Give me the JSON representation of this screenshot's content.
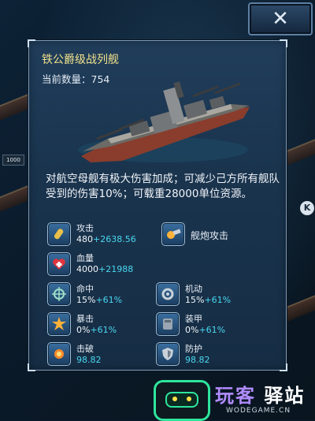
{
  "window": {
    "close_label": "✕"
  },
  "background": {
    "tag": "1000"
  },
  "side_button": {
    "label": "K"
  },
  "ship": {
    "name": "铁公爵级战列舰",
    "count_label": "当前数量：",
    "count": "754",
    "description": "对航空母舰有极大伤害加成；可减少己方所有舰队受到的伤害10%；可载重28000单位资源。"
  },
  "primary_stats": [
    {
      "icon": "bullet-icon",
      "label": "攻击",
      "base": "480",
      "bonus": "+2638.56"
    },
    {
      "icon": "heart-cross-icon",
      "label": "血量",
      "base": "4000",
      "bonus": "+21988"
    }
  ],
  "attack_type": {
    "icon": "naval-gun-icon",
    "label": "舰炮攻击"
  },
  "secondary_stats": [
    {
      "icon": "crosshair-icon",
      "label": "命中",
      "base": "15%",
      "bonus": "+61%"
    },
    {
      "icon": "maneuver-icon",
      "label": "机动",
      "base": "15%",
      "bonus": "+61%"
    },
    {
      "icon": "critical-burst-icon",
      "label": "暴击",
      "base": "0%",
      "bonus": "+61%"
    },
    {
      "icon": "armor-plate-icon",
      "label": "装甲",
      "base": "0%",
      "bonus": "+61%"
    },
    {
      "icon": "pierce-icon",
      "label": "击破",
      "value": "98.82"
    },
    {
      "icon": "shield-icon",
      "label": "防护",
      "value": "98.82"
    }
  ],
  "watermark": {
    "text_a": "玩客",
    "text_b": "驿站",
    "sub": "WODEGAME.CN"
  },
  "colors": {
    "title": "#f2e28c",
    "bonus": "#4ad7f0",
    "panel": "#1a344e"
  }
}
